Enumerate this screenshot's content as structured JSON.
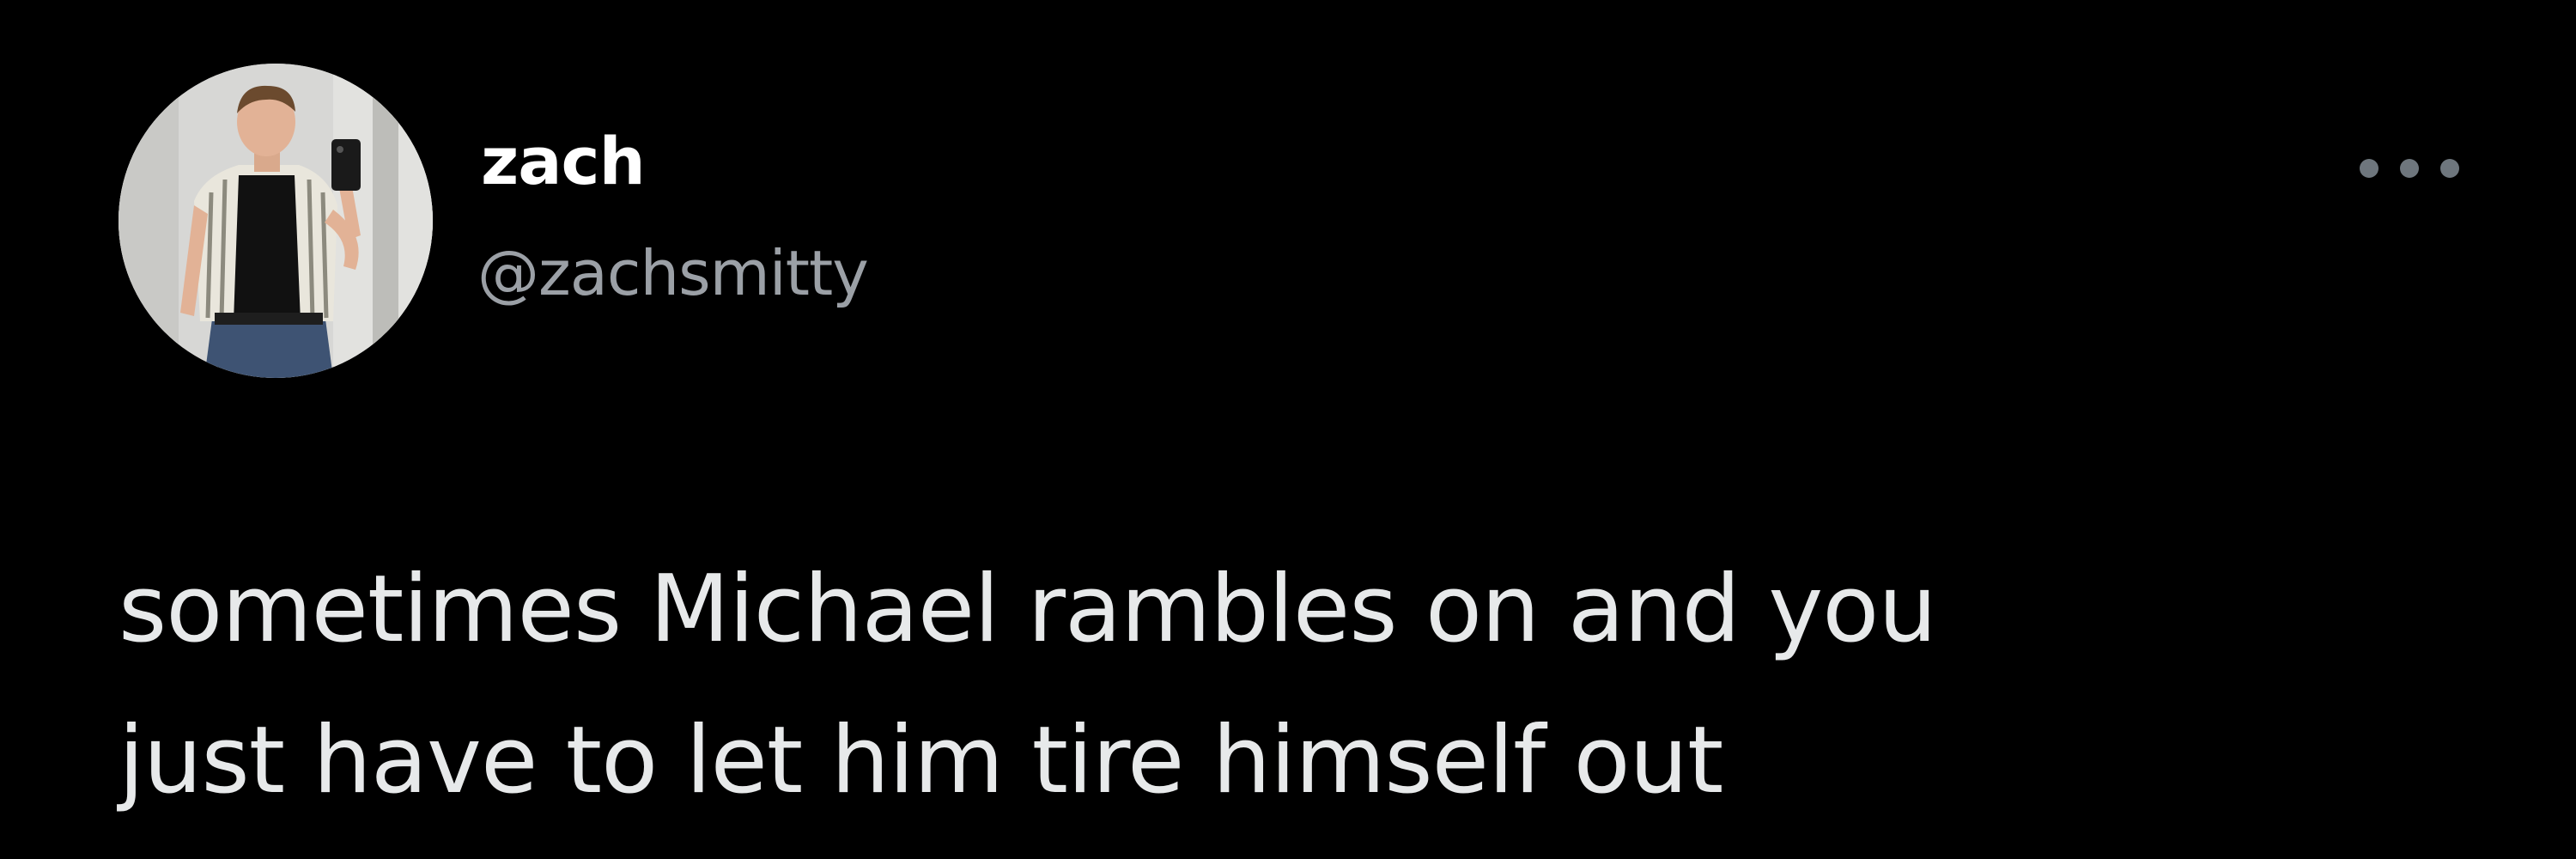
{
  "tweet": {
    "author": {
      "display_name": "zach",
      "handle": "@zachsmitty",
      "avatar_icon": "profile-photo"
    },
    "more_icon": "more-options-icon",
    "text_lines": [
      "sometimes Michael rambles on and you",
      "just have to let him tire himself out"
    ]
  },
  "colors": {
    "background": "#000000",
    "display_name": "#ffffff",
    "handle": "#9ba0a6",
    "text": "#e7e9ea",
    "more_dots": "#6e767d"
  }
}
